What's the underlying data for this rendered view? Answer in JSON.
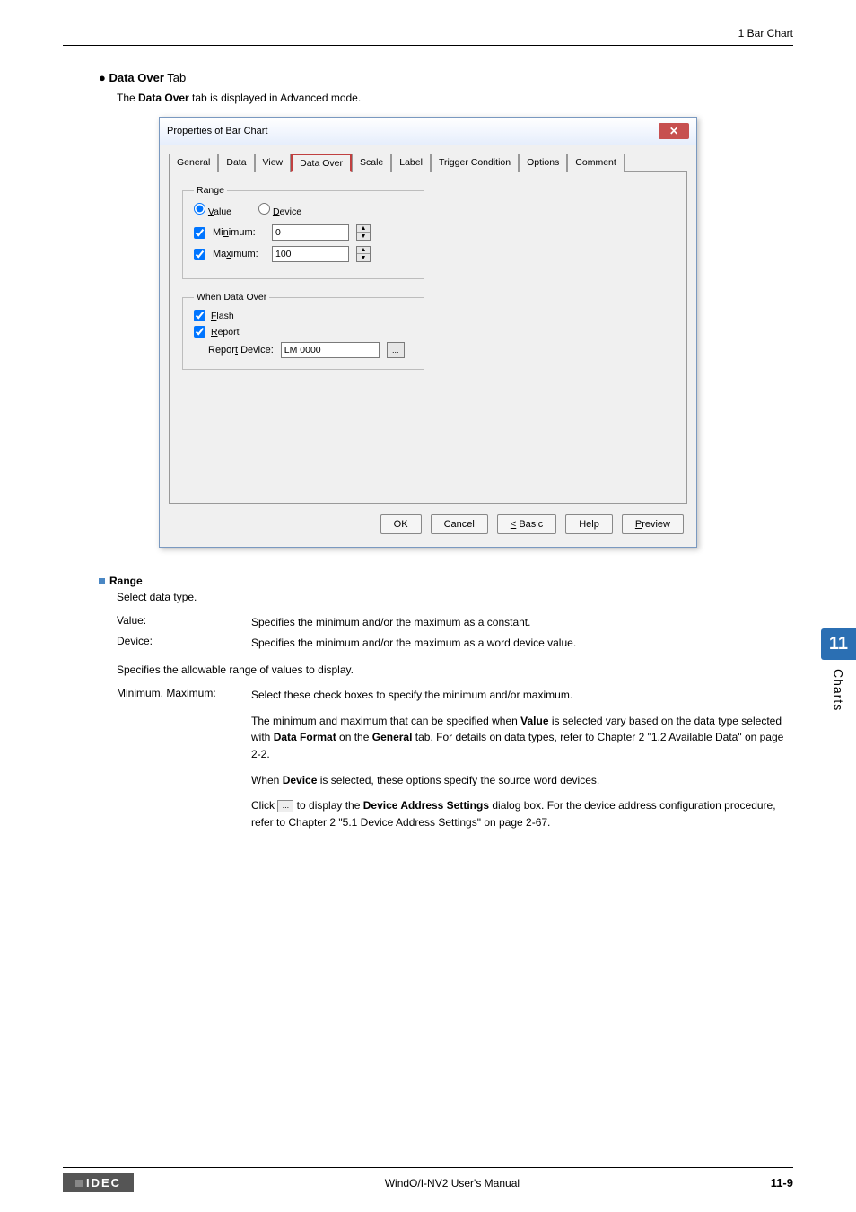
{
  "header": {
    "right": "1 Bar Chart"
  },
  "section": {
    "bullet": "●",
    "title_bold": "Data Over",
    "title_rest": " Tab",
    "intro_pre": "The ",
    "intro_bold": "Data Over",
    "intro_post": " tab is displayed in Advanced mode."
  },
  "dialog": {
    "title": "Properties of Bar Chart",
    "close": "✕",
    "tabs": [
      "General",
      "Data",
      "View",
      "Data Over",
      "Scale",
      "Label",
      "Trigger Condition",
      "Options",
      "Comment"
    ],
    "range": {
      "legend": "Range",
      "value_label": "Value",
      "device_label": "Device",
      "min_label": "Minimum:",
      "min_value": "0",
      "max_label": "Maximum:",
      "max_value": "100"
    },
    "when": {
      "legend": "When Data Over",
      "flash_label": "Flash",
      "report_label": "Report",
      "report_device_label": "Report Device:",
      "report_device_value": "LM 0000",
      "browse": "..."
    },
    "buttons": {
      "ok": "OK",
      "cancel": "Cancel",
      "basic": "< Basic",
      "help": "Help",
      "preview": "Preview"
    }
  },
  "range_section": {
    "heading": "Range",
    "select_line": "Select data type.",
    "value_term": "Value:",
    "value_desc": "Specifies the minimum and/or the maximum as a constant.",
    "device_term": "Device:",
    "device_desc": "Specifies the minimum and/or the maximum as a word device value.",
    "allowable": "Specifies the allowable range of values to display.",
    "mm_term": "Minimum, Maximum:",
    "mm_p1": "Select these check boxes to specify the minimum and/or maximum.",
    "mm_p2_pre": "The minimum and maximum that can be specified when ",
    "mm_p2_b1": "Value",
    "mm_p2_mid": " is selected vary based on the data type selected with ",
    "mm_p2_b2": "Data Format",
    "mm_p2_mid2": " on the ",
    "mm_p2_b3": "General",
    "mm_p2_post": " tab. For details on data types, refer to Chapter 2 \"1.2 Available Data\" on page 2-2.",
    "mm_p3_pre": "When ",
    "mm_p3_b": "Device",
    "mm_p3_post": " is selected, these options specify the source word devices.",
    "mm_p4_pre": "Click ",
    "mm_p4_btn": "...",
    "mm_p4_mid": " to display the ",
    "mm_p4_b": "Device Address Settings",
    "mm_p4_post": " dialog box. For the device address configuration procedure, refer to Chapter 2 \"5.1 Device Address Settings\" on page 2-67."
  },
  "sidetab": {
    "num": "11",
    "label": "Charts"
  },
  "footer": {
    "brand": "IDEC",
    "center": "WindO/I-NV2 User's Manual",
    "page": "11-9"
  }
}
